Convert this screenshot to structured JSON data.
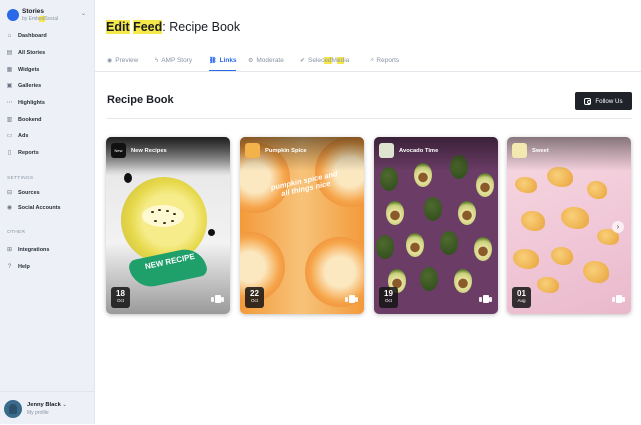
{
  "sidebar": {
    "brand_name": "Stories",
    "brand_sub_prefix": "by Emb",
    "brand_sub_highlight": "ed",
    "brand_sub_suffix": "Social",
    "items": [
      {
        "label": "Dashboard",
        "icon": "home-icon"
      },
      {
        "label": "All Stories",
        "icon": "grid-icon"
      },
      {
        "label": "Widgets",
        "icon": "widgets-icon"
      },
      {
        "label": "Galleries",
        "icon": "gallery-icon"
      },
      {
        "label": "Highlights",
        "icon": "dots-icon"
      },
      {
        "label": "Bookend",
        "icon": "bookend-icon"
      },
      {
        "label": "Ads",
        "icon": "ads-icon"
      },
      {
        "label": "Reports",
        "icon": "report-icon"
      }
    ],
    "settings_label": "SETTINGS",
    "settings_items": [
      {
        "label": "Sources",
        "icon": "sources-icon"
      },
      {
        "label": "Social Accounts",
        "icon": "user-icon"
      }
    ],
    "other_label": "OTHER",
    "other_items": [
      {
        "label": "Integrations",
        "icon": "integrations-icon"
      },
      {
        "label": "Help",
        "icon": "help-icon"
      }
    ],
    "profile": {
      "name": "Jenny Black",
      "sub": "My profile"
    }
  },
  "header": {
    "title_part1": "Edit",
    "title_part2": "Feed",
    "title_rest": ": Recipe Book"
  },
  "tabs": [
    {
      "label": "Preview",
      "icon": "eye-icon"
    },
    {
      "label": "AMP Story",
      "icon": "bolt-icon"
    },
    {
      "label": "Links",
      "icon": "link-icon"
    },
    {
      "label": "Moderate",
      "icon": "gear-icon"
    },
    {
      "label_a": "Selec",
      "label_hl1": "ed",
      "label_b": " M",
      "label_hl2": "ed",
      "label_c": "ia",
      "icon": "check-circle-icon"
    },
    {
      "label": "Reports",
      "icon": "chart-icon"
    }
  ],
  "feed": {
    "title": "Recipe Book",
    "follow_label": "Follow Us"
  },
  "cards": [
    {
      "title": "New Recipes",
      "logo": "New",
      "day": "18",
      "month": "Oct",
      "overlay": "NEW RECIPE"
    },
    {
      "title": "Pumpkin Spice",
      "day": "22",
      "month": "Oct",
      "overlay": "pumpkin spice and all things nice"
    },
    {
      "title": "Avocado Time",
      "day": "19",
      "month": "Oct"
    },
    {
      "title": "Sweet",
      "day": "01",
      "month": "Aug",
      "arrow": "›"
    }
  ]
}
